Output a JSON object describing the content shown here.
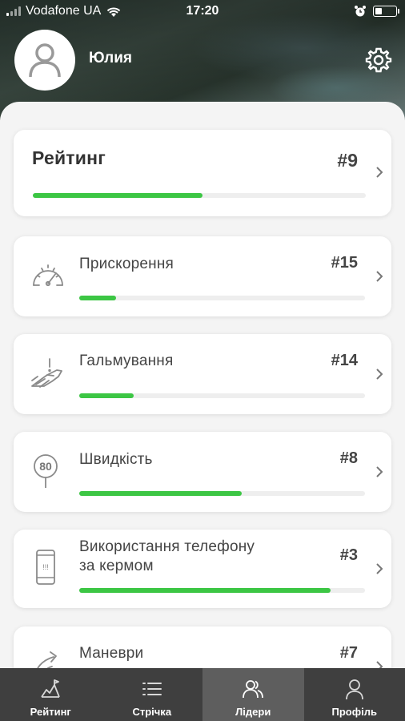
{
  "status": {
    "carrier": "Vodafone UA",
    "time": "17:20"
  },
  "profile": {
    "name": "Юлия"
  },
  "rating": {
    "label": "Рейтинг",
    "rank": "#9",
    "progress": 0.51
  },
  "categories": [
    {
      "label": "Прискорення",
      "rank": "#15",
      "progress": 0.13,
      "icon": "speedometer-icon"
    },
    {
      "label": "Гальмування",
      "rank": "#14",
      "progress": 0.19,
      "icon": "braking-icon"
    },
    {
      "label": "Швидкість",
      "rank": "#8",
      "progress": 0.57,
      "icon": "speed-limit-icon",
      "icon_text": "80"
    },
    {
      "label": "Використання телефону",
      "label2": "за кермом",
      "rank": "#3",
      "progress": 0.88,
      "icon": "phone-icon",
      "icon_text": "!!!"
    },
    {
      "label": "Маневри",
      "rank": "#7",
      "progress": 0.0,
      "icon": "maneuver-icon"
    }
  ],
  "tabs": [
    {
      "label": "Рейтинг",
      "icon": "rating-chart-icon",
      "active": false
    },
    {
      "label": "Стрічка",
      "icon": "list-icon",
      "active": false
    },
    {
      "label": "Лідери",
      "icon": "leaders-icon",
      "active": true
    },
    {
      "label": "Профіль",
      "icon": "profile-icon",
      "active": false
    }
  ],
  "colors": {
    "accent": "#3cc644",
    "tabbar": "#3f3f3f",
    "tab_active": "#5e5e5e"
  }
}
